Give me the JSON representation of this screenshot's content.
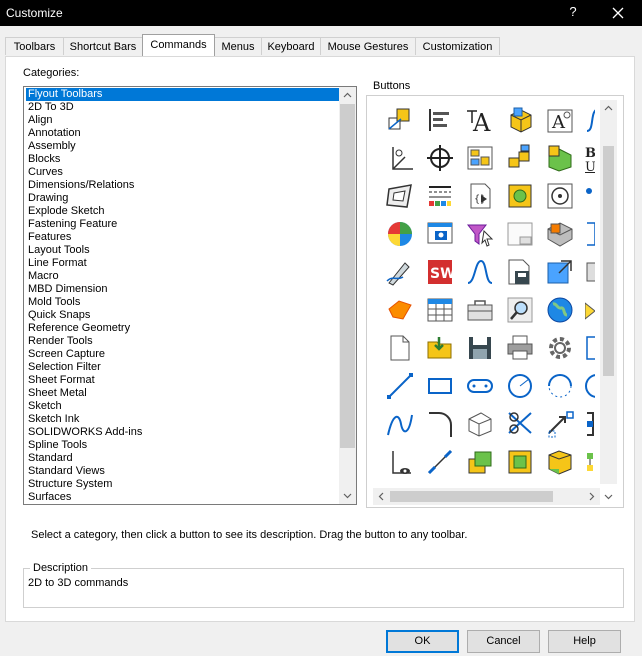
{
  "window": {
    "title": "Customize",
    "help_glyph": "?",
    "close_glyph": "✕"
  },
  "tabs": [
    "Toolbars",
    "Shortcut Bars",
    "Commands",
    "Menus",
    "Keyboard",
    "Mouse Gestures",
    "Customization"
  ],
  "active_tab": "Commands",
  "categories": {
    "label": "Categories:",
    "selected": "Flyout Toolbars",
    "items": [
      "Flyout Toolbars",
      "2D To 3D",
      "Align",
      "Annotation",
      "Assembly",
      "Blocks",
      "Curves",
      "Dimensions/Relations",
      "Drawing",
      "Explode Sketch",
      "Fastening Feature",
      "Features",
      "Layout Tools",
      "Line Format",
      "Macro",
      "MBD Dimension",
      "Mold Tools",
      "Quick Snaps",
      "Reference Geometry",
      "Render Tools",
      "Screen Capture",
      "Selection Filter",
      "Sheet Format",
      "Sheet Metal",
      "Sketch",
      "Sketch Ink",
      "SOLIDWORKS Add-ins",
      "Spline Tools",
      "Standard",
      "Standard Views",
      "Structure System",
      "Surfaces"
    ]
  },
  "buttons": {
    "label": "Buttons",
    "icons": [
      "iso-view-icon",
      "align-left-icon",
      "text-style-icon",
      "cube-yellow-icon",
      "note-icon",
      "spline-icon",
      "origin-axis-icon",
      "crosshair-icon",
      "layout-grid-icon",
      "assembly-blocks-icon",
      "colored-parts-icon",
      "bold-underline-icon",
      "sheet-frame-icon",
      "line-format-icon",
      "macro-script-icon",
      "gear-yellow-icon",
      "target-circle-icon",
      "point-icon",
      "render-sphere-icon",
      "screen-capture-icon",
      "filter-icon",
      "sheet-format-icon",
      "sheet-metal-icon",
      "partial-icon",
      "sketch-pen-icon",
      "solidworks-logo-icon",
      "spline-curve-icon",
      "save-doc-icon",
      "view-arrow-icon",
      "partial-icon",
      "flag-icon",
      "table-icon",
      "toolbox-icon",
      "magnifier-icon",
      "globe-icon",
      "partial-icon",
      "new-document-icon",
      "open-folder-icon",
      "save-disk-icon",
      "print-icon",
      "settings-gear-icon",
      "partial-icon",
      "line-icon",
      "rectangle-icon",
      "slot-icon",
      "circle-icon",
      "arc-icon",
      "partial-icon",
      "spline-draw-icon",
      "fillet-icon",
      "plane-icon",
      "trim-icon",
      "convert-icon",
      "partial-icon",
      "dimension-icon",
      "smart-dimension-icon",
      "extrude-icon",
      "revolve-icon",
      "sweep-icon",
      "partial-icon"
    ]
  },
  "hint": "Select a category, then click a button to see its description. Drag the button to any toolbar.",
  "description": {
    "legend": "Description",
    "text": "2D to 3D commands"
  },
  "footer": {
    "ok": "OK",
    "cancel": "Cancel",
    "help": "Help"
  }
}
